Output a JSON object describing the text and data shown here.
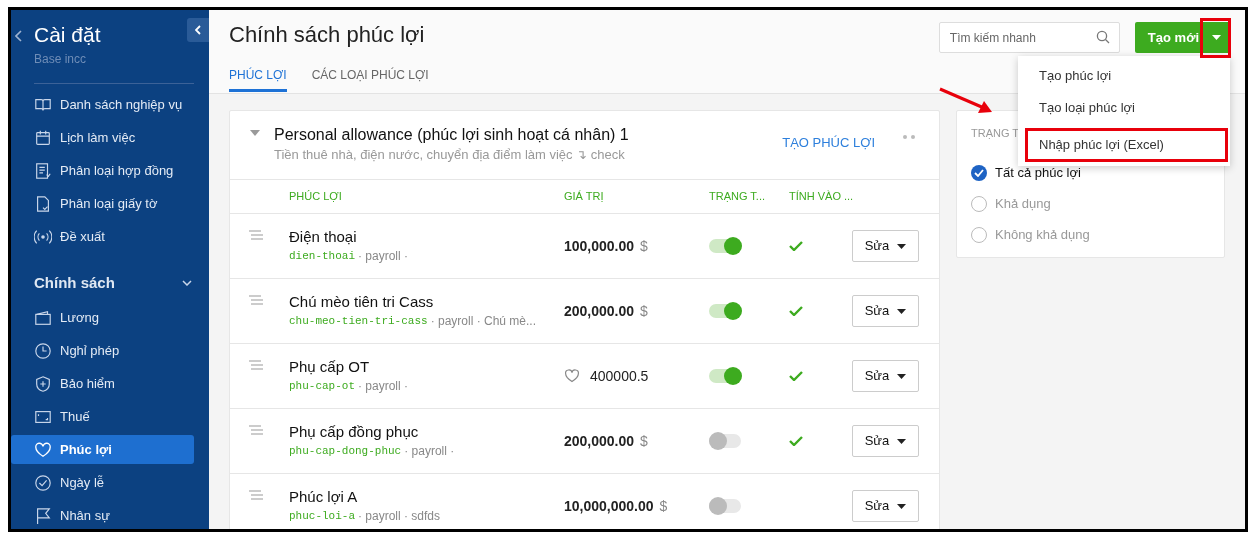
{
  "sidebar": {
    "title": "Cài đặt",
    "subtitle": "Base incc",
    "items": [
      {
        "label": "Danh sách nghiệp vụ",
        "selected": false
      },
      {
        "label": "Lịch làm việc",
        "selected": false
      },
      {
        "label": "Phân loại hợp đồng",
        "selected": false
      },
      {
        "label": "Phân loại giấy tờ",
        "selected": false
      },
      {
        "label": "Đề xuất",
        "selected": false
      }
    ],
    "section": {
      "label": "Chính sách",
      "expanded": true,
      "items": [
        {
          "label": "Lương",
          "selected": false
        },
        {
          "label": "Nghỉ phép",
          "selected": false
        },
        {
          "label": "Bảo hiểm",
          "selected": false
        },
        {
          "label": "Thuế",
          "selected": false
        },
        {
          "label": "Phúc lợi",
          "selected": true
        },
        {
          "label": "Ngày lễ",
          "selected": false
        },
        {
          "label": "Nhân sự",
          "selected": false
        }
      ]
    }
  },
  "page": {
    "title": "Chính sách phúc lợi",
    "tabs": [
      {
        "label": "PHÚC LỢI",
        "selected": true
      },
      {
        "label": "CÁC LOẠI PHÚC LỢI",
        "selected": false
      }
    ],
    "search": {
      "placeholder": "Tìm kiếm nhanh"
    },
    "create_button": "Tạo mới",
    "menu": [
      {
        "label": "Tạo phúc lợi",
        "highlighted": false
      },
      {
        "label": "Tạo loại phúc lợi",
        "highlighted": false
      },
      {
        "label": "Nhập phúc lợi (Excel)",
        "highlighted": true
      }
    ]
  },
  "group": {
    "title": "Personal allowance (phúc lợi sinh hoạt cá nhân) 1",
    "subtitle": "Tiền thuê nhà, điện nước, chuyển địa điểm làm việc ↴ check",
    "link": "TẠO PHÚC LỢI",
    "columns": [
      "PHÚC LỢI",
      "GIÁ TRỊ",
      "TRẠNG T...",
      "TÍNH VÀO ..."
    ],
    "rows": [
      {
        "name": "Điện thoại",
        "code": "dien-thoai",
        "meta": "· payroll ·",
        "kind": "currency",
        "value": "100,000.00",
        "unit": "$",
        "enabled": true,
        "counted": true,
        "action": "Sửa"
      },
      {
        "name": "Chú mèo tiên tri Cass",
        "code": "chu-meo-tien-tri-cass",
        "meta": "· payroll · Chú mè...",
        "kind": "currency",
        "value": "200,000.00",
        "unit": "$",
        "enabled": true,
        "counted": true,
        "action": "Sửa"
      },
      {
        "name": "Phụ cấp OT",
        "code": "phu-cap-ot",
        "meta": "· payroll ·",
        "kind": "heart",
        "value": "400000.5",
        "enabled": true,
        "counted": true,
        "action": "Sửa"
      },
      {
        "name": "Phụ cấp đồng phục",
        "code": "phu-cap-dong-phuc",
        "meta": "· payroll ·",
        "kind": "currency",
        "value": "200,000.00",
        "unit": "$",
        "enabled": false,
        "counted": true,
        "action": "Sửa"
      },
      {
        "name": "Phúc lợi A",
        "code": "phuc-loi-a",
        "meta": "· payroll · sdfds",
        "kind": "currency",
        "value": "10,000,000.00",
        "unit": "$",
        "enabled": false,
        "counted": false,
        "action": "Sửa"
      }
    ]
  },
  "filter": {
    "title": "TRẠNG T",
    "options": [
      {
        "label": "Tất cả phúc lợi",
        "selected": true
      },
      {
        "label": "Khả dụng",
        "selected": false
      },
      {
        "label": "Không khả dụng",
        "selected": false
      }
    ]
  }
}
